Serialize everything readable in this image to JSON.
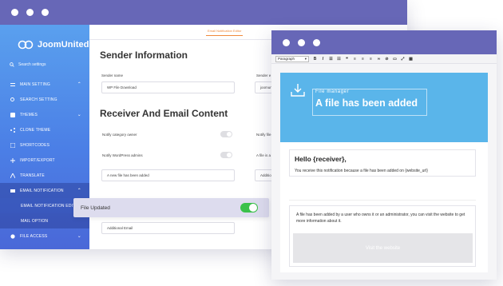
{
  "back_window": {
    "brand": "JoomUnited",
    "search_placeholder": "Search settings",
    "menu": [
      {
        "label": "MAIN SETTING",
        "chevron": "⌃"
      },
      {
        "label": "SEARCH SETTING"
      },
      {
        "label": "THEMES",
        "chevron": "⌄"
      },
      {
        "label": "CLONE THEME"
      },
      {
        "label": "SHORTCODES"
      },
      {
        "label": "IMPORT/EXPORT"
      },
      {
        "label": "TRANSLATE"
      },
      {
        "label": "EMAIL NOTIFICATION",
        "chevron": "⌃"
      },
      {
        "label": "EMAIL NOTIFICATION EDITOR"
      },
      {
        "label": "MAIL OPTION"
      },
      {
        "label": "FILE ACCESS",
        "chevron": "⌄"
      }
    ],
    "active_tab": "Email Notification Editor",
    "sender_heading": "Sender Information",
    "sender_name_label": "Sender name",
    "sender_name_value": "WP File Download",
    "sender_email_label": "Sender e",
    "sender_email_value": "joomun",
    "receiver_heading": "Receiver And Email Content",
    "notify_category_owner": "Notify category owner",
    "notify_file_label": "Notify file",
    "notify_wp_admins": "Notify WordPress admins",
    "file_is_label": "A file is a",
    "new_file_subject": "A new file has been added",
    "additional_short": "Additio",
    "additional_email": "Additional Email"
  },
  "float_bar": {
    "label": "File Updated",
    "toggle_state": "on"
  },
  "editor": {
    "format_select": "Paragraph",
    "hero_small": "File manager",
    "hero_title": "A file has been added",
    "greeting": "Hello {receiver},",
    "notice": "You receive this notification because a file has been added on {website_url}",
    "body": "A file has been added by a user who owns it or an administrator, you can visit the website to get more information about it.",
    "button": "Visit the website"
  },
  "colors": {
    "titlebar": "#6767b7",
    "sidebar_top": "#5aa0ee",
    "hero": "#5ab5ea",
    "accent_tab": "#f08a3c",
    "toggle_on": "#3ac14a"
  }
}
